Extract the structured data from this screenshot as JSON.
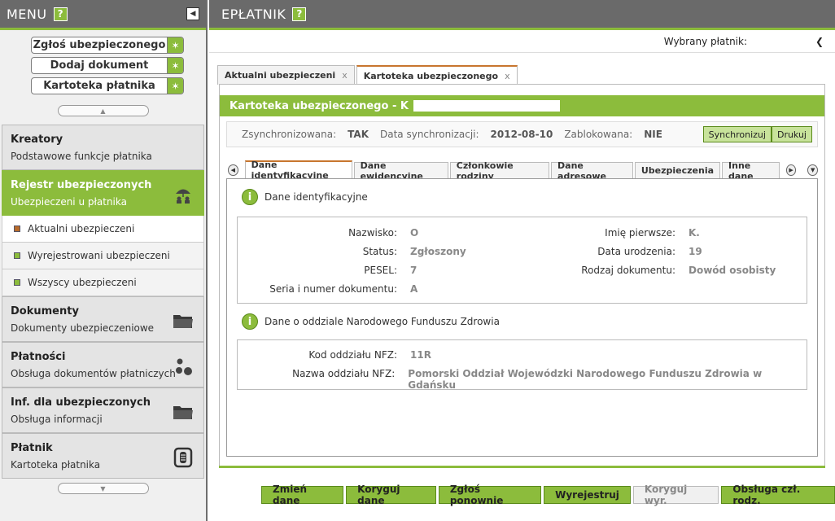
{
  "sidebar": {
    "title": "MENU",
    "help_label": "?",
    "quick_actions": [
      {
        "label": "Zgłoś ubezpieczonego"
      },
      {
        "label": "Dodaj dokument"
      },
      {
        "label": "Kartoteka płatnika"
      }
    ],
    "sections": [
      {
        "title": "Kreatory",
        "subtitle": "Podstawowe funkcje płatnika"
      },
      {
        "title": "Rejestr ubezpieczonych",
        "subtitle": "Ubezpieczeni u płatnika"
      },
      {
        "title": "Dokumenty",
        "subtitle": "Dokumenty ubezpieczeniowe"
      },
      {
        "title": "Płatności",
        "subtitle": "Obsługa dokumentów płatniczych"
      },
      {
        "title": "Inf. dla ubezpieczonych",
        "subtitle": "Obsługa informacji"
      },
      {
        "title": "Płatnik",
        "subtitle": "Kartoteka płatnika"
      }
    ],
    "sub_items": [
      {
        "label": "Aktualni ubezpieczeni"
      },
      {
        "label": "Wyrejestrowani ubezpieczeni"
      },
      {
        "label": "Wszyscy ubezpieczeni"
      }
    ],
    "accent_color": "#8cbc3c"
  },
  "main": {
    "title": "EPŁATNIK",
    "help_label": "?",
    "payer_label": "Wybrany płatnik:",
    "outer_tabs": [
      {
        "label": "Aktualni ubezpieczeni",
        "close": "x"
      },
      {
        "label": "Kartoteka ubezpieczonego",
        "close": "x"
      }
    ],
    "panel_title": "Kartoteka ubezpieczonego - K",
    "sync": {
      "synced_label": "Zsynchronizowana:",
      "synced_value": "TAK",
      "date_label": "Data synchronizacji:",
      "date_value": "2012-08-10",
      "locked_label": "Zablokowana:",
      "locked_value": "NIE",
      "sync_button": "Synchronizuj",
      "print_button": "Drukuj"
    },
    "inner_tabs": [
      {
        "label": "Dane identyfikacyjne"
      },
      {
        "label": "Dane ewidencyjne"
      },
      {
        "label": "Członkowie rodziny"
      },
      {
        "label": "Dane adresowe"
      },
      {
        "label": "Ubezpieczenia"
      },
      {
        "label": "Inne dane"
      }
    ],
    "identity_section": {
      "heading": "Dane identyfikacyjne",
      "surname_label": "Nazwisko:",
      "surname_value": "O",
      "status_label": "Status:",
      "status_value": "Zgłoszony",
      "pesel_label": "PESEL:",
      "pesel_value": "7",
      "doc_label": "Seria i numer dokumentu:",
      "doc_value": "A",
      "firstname_label": "Imię pierwsze:",
      "firstname_value": "K.",
      "birthdate_label": "Data urodzenia:",
      "birthdate_value": "19",
      "doctype_label": "Rodzaj dokumentu:",
      "doctype_value": "Dowód osobisty"
    },
    "nfz_section": {
      "heading": "Dane o oddziale Narodowego Funduszu Zdrowia",
      "code_label": "Kod oddziału NFZ:",
      "code_value": "11R",
      "name_label": "Nazwa oddziału NFZ:",
      "name_value": "Pomorski Oddział Wojewódzki Narodowego Funduszu Zdrowia w Gdańsku"
    },
    "actions": [
      {
        "label": "Zmień dane"
      },
      {
        "label": "Koryguj dane"
      },
      {
        "label": "Zgłoś ponownie"
      },
      {
        "label": "Wyrejestruj"
      },
      {
        "label": "Koryguj wyr."
      },
      {
        "label": "Obsługa czł. rodz."
      }
    ]
  }
}
